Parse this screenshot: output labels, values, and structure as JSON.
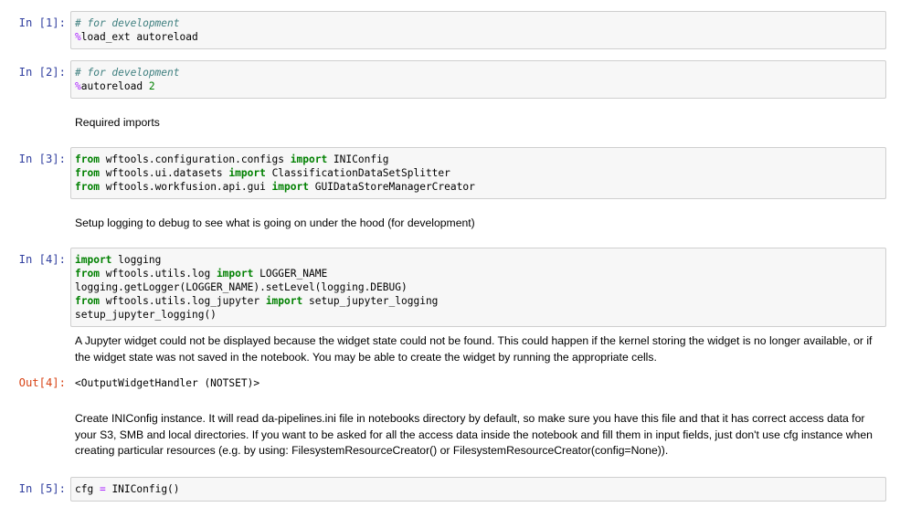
{
  "cells": {
    "c1": {
      "prompt": "In [1]:",
      "line1": "# for development",
      "line2_magic": "%",
      "line2_rest": "load_ext autoreload"
    },
    "c2": {
      "prompt": "In [2]:",
      "line1": "# for development",
      "line2_magic": "%",
      "line2_rest": "autoreload ",
      "line2_num": "2"
    },
    "md1": "Required imports",
    "c3": {
      "prompt": "In [3]:",
      "l1_kw1": "from",
      "l1_mod": " wftools.configuration.configs ",
      "l1_kw2": "import",
      "l1_name": " INIConfig",
      "l2_kw1": "from",
      "l2_mod": " wftools.ui.datasets ",
      "l2_kw2": "import",
      "l2_name": " ClassificationDataSetSplitter",
      "l3_kw1": "from",
      "l3_mod": " wftools.workfusion.api.gui ",
      "l3_kw2": "import",
      "l3_name": " GUIDataStoreManagerCreator"
    },
    "md2": "Setup logging to debug to see what is going on under the hood (for development)",
    "c4": {
      "prompt": "In [4]:",
      "l1_kw": "import",
      "l1_rest": " logging",
      "l2_kw1": "from",
      "l2_mod": " wftools.utils.log ",
      "l2_kw2": "import",
      "l2_name": " LOGGER_NAME",
      "l3": "logging.getLogger(LOGGER_NAME).setLevel(logging.DEBUG)",
      "l4_kw1": "from",
      "l4_mod": " wftools.utils.log_jupyter ",
      "l4_kw2": "import",
      "l4_name": " setup_jupyter_logging",
      "l5": "setup_jupyter_logging()",
      "widget_msg": "A Jupyter widget could not be displayed because the widget state could not be found. This could happen if the kernel storing the widget is no longer available, or if the widget state was not saved in the notebook. You may be able to create the widget by running the appropriate cells.",
      "out_prompt": "Out[4]:",
      "out_text": "<OutputWidgetHandler (NOTSET)>"
    },
    "md3": "Create INIConfig instance. It will read da-pipelines.ini file in notebooks directory by default, so make sure you have this file and that it has correct access data for your S3, SMB and local directories. If you want to be asked for all the access data inside the notebook and fill them in input fields, just don't use cfg instance when creating particular resources (e.g. by using: FilesystemResourceCreator() or FilesystemResourceCreator(config=None)).",
    "c5": {
      "prompt": "In [5]:",
      "l1_a": "cfg ",
      "l1_op": "=",
      "l1_b": " INIConfig()"
    }
  }
}
